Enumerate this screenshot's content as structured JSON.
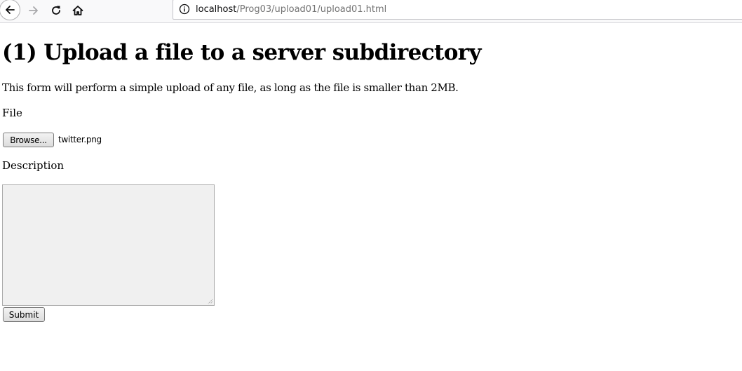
{
  "browser": {
    "url_host": "localhost",
    "url_path": "/Prog03/upload01/upload01.html",
    "icons": [
      "back-arrow-icon",
      "forward-arrow-icon",
      "reload-icon",
      "home-icon",
      "info-icon"
    ]
  },
  "page": {
    "title": "(1) Upload a file to a server subdirectory",
    "intro": "This form will perform a simple upload of any file, as long as the file is smaller than 2MB."
  },
  "form": {
    "file_label": "File",
    "browse_label": "Browse...",
    "file_name": "twitter.png",
    "description_label": "Description",
    "description_value": "",
    "submit_label": "Submit"
  }
}
